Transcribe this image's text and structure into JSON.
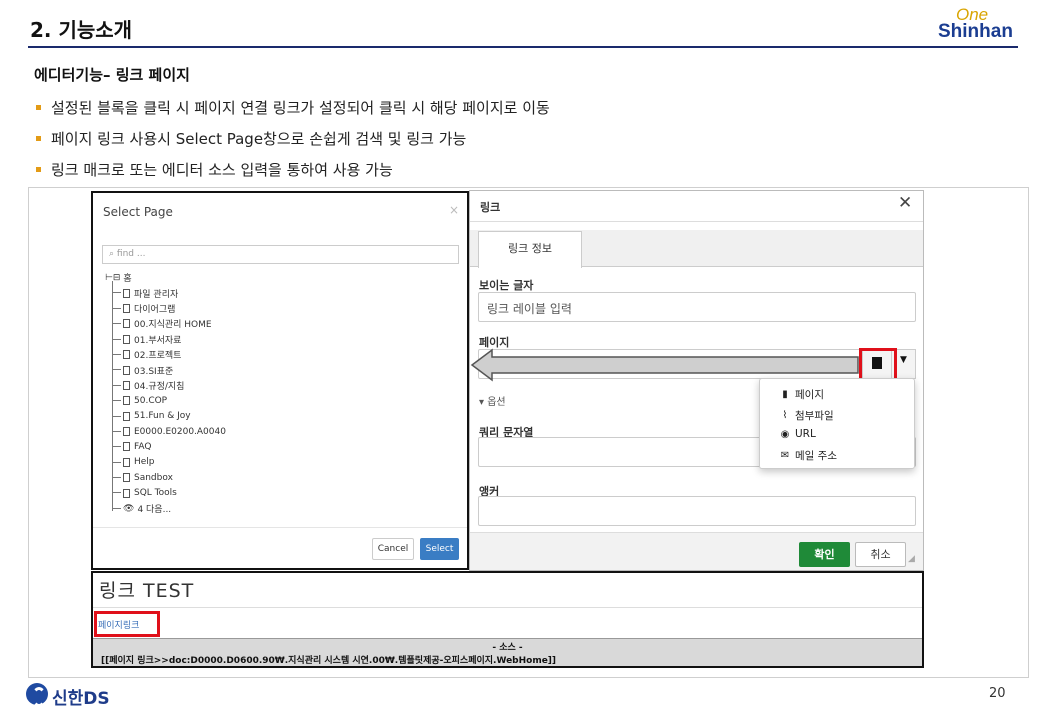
{
  "header": {
    "slide_title": "2. 기능소개",
    "brand_one": "One",
    "brand_shinhan": "Shinhan"
  },
  "section": {
    "heading": "에디터기능– 링크 페이지",
    "bullets": [
      "설정된 블록을 클릭 시 페이지 연결 링크가 설정되어 클릭 시  해당 페이지로 이동",
      "페이지 링크 사용시 Select Page창으로 손쉽게 검색 및 링크 가능",
      "링크 매크로 또는 에디터 소스 입력을 통하여 사용 가능"
    ]
  },
  "select_page": {
    "title": "Select Page",
    "close": "×",
    "find_placeholder": "find ...",
    "root": "홈",
    "items": [
      "파일 관리자",
      "다이어그램",
      "00.지식관리 HOME",
      "01.부서자료",
      "02.프로젝트",
      "03.SI표준",
      "04.규정/지침",
      "50.COP",
      "51.Fun & Joy",
      "E0000.E0200.A0040",
      "FAQ",
      "Help",
      "Sandbox",
      "SQL Tools"
    ],
    "more": "4 다음...",
    "cancel_label": "Cancel",
    "select_label": "Select"
  },
  "link_dialog": {
    "title": "링크",
    "close": "✕",
    "tab_label": "링크 정보",
    "visible_text_label": "보이는 글자",
    "visible_text_value": "링크 레이블 입력",
    "page_label": "페이지",
    "options_label": "옵션",
    "query_label": "쿼리 문자열",
    "anchor_label": "앵커",
    "ok_label": "확인",
    "cancel_label": "취소"
  },
  "dropdown_menu": {
    "items": [
      {
        "label": "페이지",
        "icon": "page-icon"
      },
      {
        "label": "첨부파일",
        "icon": "paperclip-icon"
      },
      {
        "label": "URL",
        "icon": "globe-icon"
      },
      {
        "label": "메일 주소",
        "icon": "envelope-icon"
      }
    ]
  },
  "result": {
    "title": "링크 TEST",
    "page_link": "페이지링크",
    "source_label": "- 소스 -",
    "source_code": "[[페이지 링크>>doc:D0000.D0600.90₩.지식관리 시스템 시연.00₩.템플릿제공-오피스페이지.WebHome]]"
  },
  "footer": {
    "logo": "신한DS",
    "page_number": "20"
  },
  "colors": {
    "accent_orange": "#e39b16",
    "brand_blue": "#1b3d91",
    "highlight_red": "#e0101a",
    "ok_green": "#1f8a38",
    "select_blue": "#3a7dc4"
  }
}
